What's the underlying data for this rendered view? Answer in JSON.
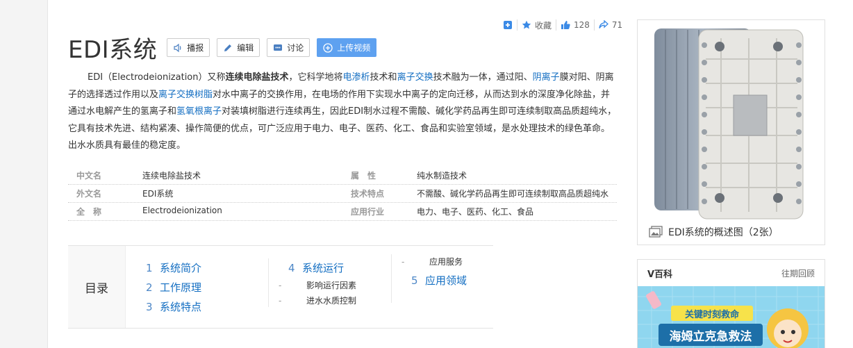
{
  "actions": {
    "collect": "收藏",
    "likes": "128",
    "shares": "71"
  },
  "title": "EDI系统",
  "buttons": {
    "broadcast": "播报",
    "edit": "编辑",
    "discuss": "讨论",
    "upload_video": "上传视频"
  },
  "summary": {
    "p1": "EDI（Electrodeionization）又称",
    "b1": "连续电除盐技术",
    "p2": "，它科学地将",
    "l1": "电渗析",
    "p3": "技术和",
    "l2": "离子交换",
    "p4": "技术融为一体，通过阳、",
    "l3": "阴离子",
    "p5": "膜对阳、阴离子的选择透过作用以及",
    "l4": "离子交换树脂",
    "p6": "对水中离子的交换作用，在电场的作用下实现水中离子的定向迁移，从而达到水的深度净化除盐，并通过水电解产生的氢离子和",
    "l5": "氢氧根离子",
    "p7": "对装填树脂进行连续再生，因此EDI制水过程不需酸、碱化学药品再生即可连续制取高品质超纯水，它具有技术先进、结构紧凑、操作简便的优点，可广泛应用于电力、电子、医药、化工、食品和实验室领域，是水处理技术的绿色革命。 出水水质具有最佳的稳定度。"
  },
  "basic_info": [
    {
      "n1": "中文名",
      "v1": "连续电除盐技术",
      "n2": "属　性",
      "v2": "纯水制造技术"
    },
    {
      "n1": "外文名",
      "v1": "EDI系统",
      "n2": "技术特点",
      "v2": "不需酸、碱化学药品再生即可连续制取高品质超纯水"
    },
    {
      "n1": "全　称",
      "v1": "Electrodeionization",
      "n2": "应用行业",
      "v2": "电力、电子、医药、化工、食品"
    }
  ],
  "catalog": {
    "title": "目录",
    "col1": [
      {
        "num": "1",
        "label": "系统简介"
      },
      {
        "num": "2",
        "label": "工作原理"
      },
      {
        "num": "3",
        "label": "系统特点"
      }
    ],
    "col2": {
      "item": {
        "num": "4",
        "label": "系统运行"
      },
      "subs": [
        "影响运行因素",
        "进水水质控制"
      ]
    },
    "col3": {
      "sub": "应用服务",
      "item": {
        "num": "5",
        "label": "应用领域"
      }
    }
  },
  "album": {
    "caption": "EDI系统的概述图（2张）"
  },
  "vbaike": {
    "title": "V百科",
    "more": "往期回顾",
    "banner_line1": "关键时刻救命",
    "banner_line2": "海姆立克急救法",
    "banner_colors": {
      "bg": "#8fd6ef",
      "ribbon": "#f7e24a",
      "text": "#1d6fa8"
    }
  },
  "colors": {
    "link": "#136ec2",
    "primary_button": "#5ea1f0"
  }
}
